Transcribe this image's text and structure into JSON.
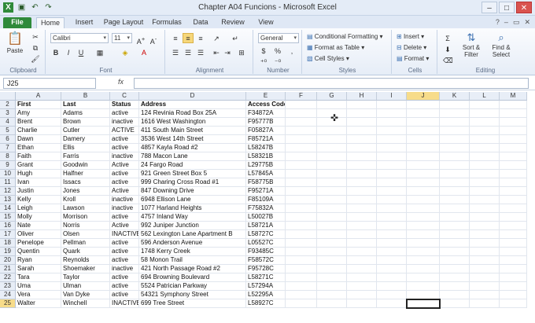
{
  "window": {
    "title": "Chapter A04 Funcions - Microsoft Excel"
  },
  "quick_access": [
    "excel-icon",
    "save-icon",
    "undo-icon",
    "redo-icon"
  ],
  "tabs": [
    "File",
    "Home",
    "Insert",
    "Page Layout",
    "Formulas",
    "Data",
    "Review",
    "View"
  ],
  "active_tab": "Home",
  "ribbon": {
    "clipboard": {
      "paste": "Paste",
      "label": "Clipboard"
    },
    "font": {
      "name": "Calibri",
      "size": "11",
      "label": "Font",
      "bold": "B",
      "italic": "I",
      "underline": "U"
    },
    "alignment": {
      "label": "Alignment"
    },
    "number": {
      "format": "General",
      "currency": "$",
      "percent": "%",
      "label": "Number"
    },
    "styles": {
      "conditional": "Conditional Formatting",
      "table": "Format as Table",
      "cell_styles": "Cell Styles",
      "label": "Styles"
    },
    "cells": {
      "insert": "Insert",
      "delete": "Delete",
      "format": "Format",
      "label": "Cells"
    },
    "editing": {
      "sigma": "Σ",
      "sort": "Sort & Filter",
      "find": "Find & Select",
      "label": "Editing"
    }
  },
  "formula_bar": {
    "name_box": "J25",
    "fx": "fx",
    "value": ""
  },
  "columns": [
    "A",
    "B",
    "C",
    "D",
    "E",
    "F",
    "G",
    "H",
    "I",
    "J",
    "K",
    "L",
    "M"
  ],
  "selected_column": "J",
  "headers": {
    "row": "2",
    "first": "First",
    "last": "Last",
    "status": "Status",
    "address": "Address",
    "access": "Access Code"
  },
  "rows": [
    {
      "n": "3",
      "first": "Amy",
      "last": "Adams",
      "status": "active",
      "address": "124 Revinia Road        Box 25A",
      "code": "F34872A"
    },
    {
      "n": "4",
      "first": "Brent",
      "last": "Brown",
      "status": "inactive",
      "address": "1616 West      Washington",
      "code": "F95777B"
    },
    {
      "n": "5",
      "first": "Charlie",
      "last": "Cutler",
      "status": "ACTIVE",
      "address": "    411 South Main Street",
      "code": "F05827A"
    },
    {
      "n": "6",
      "first": "Dawn",
      "last": "Damery",
      "status": "active",
      "address": "3536 West 14th Street",
      "code": "F85721A"
    },
    {
      "n": "7",
      "first": "Ethan",
      "last": "Ellis",
      "status": "active",
      "address": "    4857 Kayla Road    #2",
      "code": "L58247B"
    },
    {
      "n": "8",
      "first": "Faith",
      "last": "Farris",
      "status": "inactive",
      "address": "788 Macon Lane",
      "code": "L58321B"
    },
    {
      "n": "9",
      "first": "Grant",
      "last": "Goodwin",
      "status": "Active",
      "address": "24 Fargo Road",
      "code": "L29775B"
    },
    {
      "n": "10",
      "first": "Hugh",
      "last": "Halfner",
      "status": "active",
      "address": "921 Green Street      Box 5",
      "code": "L57845A"
    },
    {
      "n": "11",
      "first": "Ivan",
      "last": "Issacs",
      "status": "active",
      "address": "999 Charing Cross Road     #1",
      "code": "F58775B"
    },
    {
      "n": "12",
      "first": "Justin",
      "last": "Jones",
      "status": "Active",
      "address": "847 Downing Drive",
      "code": "F95271A"
    },
    {
      "n": "13",
      "first": "Kelly",
      "last": "Kroll",
      "status": "inactive",
      "address": "6948 Ellison Lane",
      "code": "F85109A"
    },
    {
      "n": "14",
      "first": "Leigh",
      "last": "Lawson",
      "status": "inactive",
      "address": "1077 Harland Heights",
      "code": "F75832A"
    },
    {
      "n": "15",
      "first": "Molly",
      "last": "Morrison",
      "status": "active",
      "address": "4757 Inland Way",
      "code": "L50027B"
    },
    {
      "n": "16",
      "first": "Nate",
      "last": "Norris",
      "status": "Active",
      "address": "    992 Juniper Junction",
      "code": "L58721A"
    },
    {
      "n": "17",
      "first": "Oliver",
      "last": "Olsen",
      "status": "INACTIVE",
      "address": "562 Lexington Lane      Apartment B",
      "code": "L58727C"
    },
    {
      "n": "18",
      "first": "Penelope",
      "last": "Pellman",
      "status": "active",
      "address": "    596 Anderson Avenue",
      "code": "L05527C"
    },
    {
      "n": "19",
      "first": "Quentin",
      "last": "Quark",
      "status": "active",
      "address": "    1748 Kerry Creek",
      "code": "F93485C"
    },
    {
      "n": "20",
      "first": "Ryan",
      "last": "Reynolds",
      "status": "active",
      "address": "58 Monon Trail",
      "code": "F58572C"
    },
    {
      "n": "21",
      "first": "Sarah",
      "last": "Shoemaker",
      "status": "inactive",
      "address": "421 North Passage Road     #2",
      "code": "F95728C"
    },
    {
      "n": "22",
      "first": "Tara",
      "last": "Taylor",
      "status": "active",
      "address": "694 Browning     Boulevard",
      "code": "L58271C"
    },
    {
      "n": "23",
      "first": "Uma",
      "last": "Ulman",
      "status": "active",
      "address": "        5524 Patrician Parkway",
      "code": "L57294A"
    },
    {
      "n": "24",
      "first": "Vera",
      "last": "Van Dyke",
      "status": "active",
      "address": "54321 Symphony Street",
      "code": "L52295A"
    },
    {
      "n": "25",
      "first": "Walter",
      "last": "Winchell",
      "status": "INACTIVE",
      "address": "699 Tree Street",
      "code": "L58927C"
    }
  ]
}
